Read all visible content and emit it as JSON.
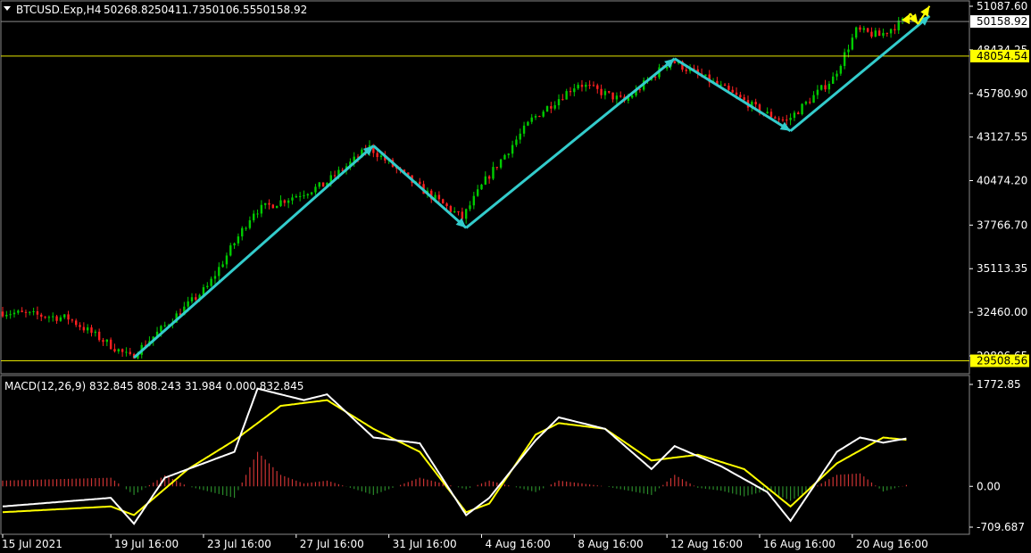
{
  "header": {
    "symbol_label": "BTCUSD.Exp,H4",
    "ohlc": [
      "50268.82",
      "50411.73",
      "50106.55",
      "50158.92"
    ]
  },
  "macd": {
    "label": "MACD(12,26,9) 832.845 808.243 31.984 0.000 832.845",
    "axis_ticks": [
      "1772.85",
      "0.00",
      "-709.687"
    ]
  },
  "price_axis": {
    "ticks": [
      "51087.60",
      "48434.25",
      "45780.90",
      "43127.55",
      "40474.20",
      "37766.70",
      "35113.35",
      "32460.00",
      "29806.65"
    ],
    "current_price_tag": "50158.92",
    "level_tags": [
      "48054.54",
      "29508.56"
    ]
  },
  "time_axis": {
    "labels": [
      "15 Jul 2021",
      "19 Jul 16:00",
      "23 Jul 16:00",
      "27 Jul 16:00",
      "31 Jul 16:00",
      "4 Aug 16:00",
      "8 Aug 16:00",
      "12 Aug 16:00",
      "16 Aug 16:00",
      "20 Aug 16:00"
    ]
  },
  "colors": {
    "bull": "#00cc00",
    "bear": "#ff2020",
    "hline": "#e6e600",
    "trend_arrow": "#33cccc",
    "forecast_arrow": "#ffff00",
    "macd_main": "#ffffff",
    "macd_signal": "#ffff00",
    "hist_pos": "#cc3333",
    "hist_neg": "#2a8a2a",
    "current_price_line": "#8a8a8a"
  },
  "chart_data": {
    "type": "candlestick",
    "series": [
      {
        "name": "BTCUSD.Exp,H4",
        "kind": "price",
        "pivots": [
          {
            "date": "2021-07-15",
            "price": 32500
          },
          {
            "date": "2021-07-18",
            "price": 32100
          },
          {
            "date": "2021-07-20 16:00",
            "price": 29700
          },
          {
            "date": "2021-07-24",
            "price": 34000
          },
          {
            "date": "2021-07-26",
            "price": 38600
          },
          {
            "date": "2021-07-29",
            "price": 40200
          },
          {
            "date": "2021-07-31",
            "price": 42500
          },
          {
            "date": "2021-08-02",
            "price": 40200
          },
          {
            "date": "2021-08-04",
            "price": 38200
          },
          {
            "date": "2021-08-05",
            "price": 40500
          },
          {
            "date": "2021-08-07",
            "price": 44200
          },
          {
            "date": "2021-08-09",
            "price": 46400
          },
          {
            "date": "2021-08-11",
            "price": 45300
          },
          {
            "date": "2021-08-13",
            "price": 47800
          },
          {
            "date": "2021-08-15",
            "price": 46300
          },
          {
            "date": "2021-08-17",
            "price": 44600
          },
          {
            "date": "2021-08-18",
            "price": 44100
          },
          {
            "date": "2021-08-20",
            "price": 46700
          },
          {
            "date": "2021-08-21",
            "price": 49600
          },
          {
            "date": "2021-08-22",
            "price": 49300
          },
          {
            "date": "2021-08-23",
            "price": 50158.92
          }
        ]
      },
      {
        "name": "MACD main",
        "kind": "macd",
        "pivots": [
          {
            "date": "2021-07-15",
            "value": -350
          },
          {
            "date": "2021-07-19 16:00",
            "value": -200
          },
          {
            "date": "2021-07-20 16:00",
            "value": -650
          },
          {
            "date": "2021-07-22",
            "value": 150
          },
          {
            "date": "2021-07-25",
            "value": 600
          },
          {
            "date": "2021-07-26",
            "value": 1700
          },
          {
            "date": "2021-07-28",
            "value": 1500
          },
          {
            "date": "2021-07-29",
            "value": 1600
          },
          {
            "date": "2021-07-31",
            "value": 850
          },
          {
            "date": "2021-08-02",
            "value": 750
          },
          {
            "date": "2021-08-04",
            "value": -500
          },
          {
            "date": "2021-08-05",
            "value": -200
          },
          {
            "date": "2021-08-07",
            "value": 800
          },
          {
            "date": "2021-08-08",
            "value": 1200
          },
          {
            "date": "2021-08-10",
            "value": 1000
          },
          {
            "date": "2021-08-12",
            "value": 300
          },
          {
            "date": "2021-08-13",
            "value": 700
          },
          {
            "date": "2021-08-15",
            "value": 350
          },
          {
            "date": "2021-08-17",
            "value": -100
          },
          {
            "date": "2021-08-18",
            "value": -600
          },
          {
            "date": "2021-08-20",
            "value": 600
          },
          {
            "date": "2021-08-21",
            "value": 850
          },
          {
            "date": "2021-08-22",
            "value": 760
          },
          {
            "date": "2021-08-23",
            "value": 832.845
          }
        ]
      },
      {
        "name": "MACD signal",
        "kind": "macd",
        "pivots": [
          {
            "date": "2021-07-15",
            "value": -450
          },
          {
            "date": "2021-07-19 16:00",
            "value": -350
          },
          {
            "date": "2021-07-20 16:00",
            "value": -500
          },
          {
            "date": "2021-07-23",
            "value": 300
          },
          {
            "date": "2021-07-25",
            "value": 800
          },
          {
            "date": "2021-07-27",
            "value": 1400
          },
          {
            "date": "2021-07-29",
            "value": 1500
          },
          {
            "date": "2021-07-31",
            "value": 1000
          },
          {
            "date": "2021-08-02",
            "value": 600
          },
          {
            "date": "2021-08-04",
            "value": -450
          },
          {
            "date": "2021-08-05",
            "value": -300
          },
          {
            "date": "2021-08-07",
            "value": 900
          },
          {
            "date": "2021-08-08",
            "value": 1100
          },
          {
            "date": "2021-08-10",
            "value": 1000
          },
          {
            "date": "2021-08-12",
            "value": 450
          },
          {
            "date": "2021-08-14",
            "value": 550
          },
          {
            "date": "2021-08-16",
            "value": 300
          },
          {
            "date": "2021-08-18",
            "value": -350
          },
          {
            "date": "2021-08-20",
            "value": 400
          },
          {
            "date": "2021-08-22",
            "value": 850
          },
          {
            "date": "2021-08-23",
            "value": 808.243
          }
        ]
      }
    ],
    "horizontal_levels": [
      48054.54,
      29508.56,
      50158.92
    ],
    "trend_arrows": [
      {
        "from": {
          "date": "2021-07-20 16:00",
          "price": 29700
        },
        "to": {
          "date": "2021-07-31",
          "price": 42600
        }
      },
      {
        "from": {
          "date": "2021-07-31",
          "price": 42600
        },
        "to": {
          "date": "2021-08-04",
          "price": 37600
        }
      },
      {
        "from": {
          "date": "2021-08-04",
          "price": 37600
        },
        "to": {
          "date": "2021-08-13",
          "price": 47900
        }
      },
      {
        "from": {
          "date": "2021-08-13",
          "price": 47900
        },
        "to": {
          "date": "2021-08-18",
          "price": 43500
        }
      },
      {
        "from": {
          "date": "2021-08-18",
          "price": 43500
        },
        "to": {
          "date": "2021-08-24",
          "price": 50500
        }
      }
    ],
    "forecast_arrows": [
      {
        "from": {
          "date": "2021-08-23",
          "price": 50200
        },
        "to": {
          "date": "2021-08-23 04:00",
          "price": 50650
        }
      },
      {
        "from": {
          "date": "2021-08-23 04:00",
          "price": 50650
        },
        "to": {
          "date": "2021-08-23 12:00",
          "price": 50000
        }
      },
      {
        "from": {
          "date": "2021-08-23 12:00",
          "price": 50000
        },
        "to": {
          "date": "2021-08-24",
          "price": 51100
        }
      }
    ],
    "price_range": [
      29806.65,
      51087.6
    ],
    "macd_range": [
      -709.687,
      1772.85
    ],
    "date_range": [
      "2021-07-15",
      "2021-08-24 08:00"
    ],
    "grid": false,
    "legend": "top-left"
  }
}
